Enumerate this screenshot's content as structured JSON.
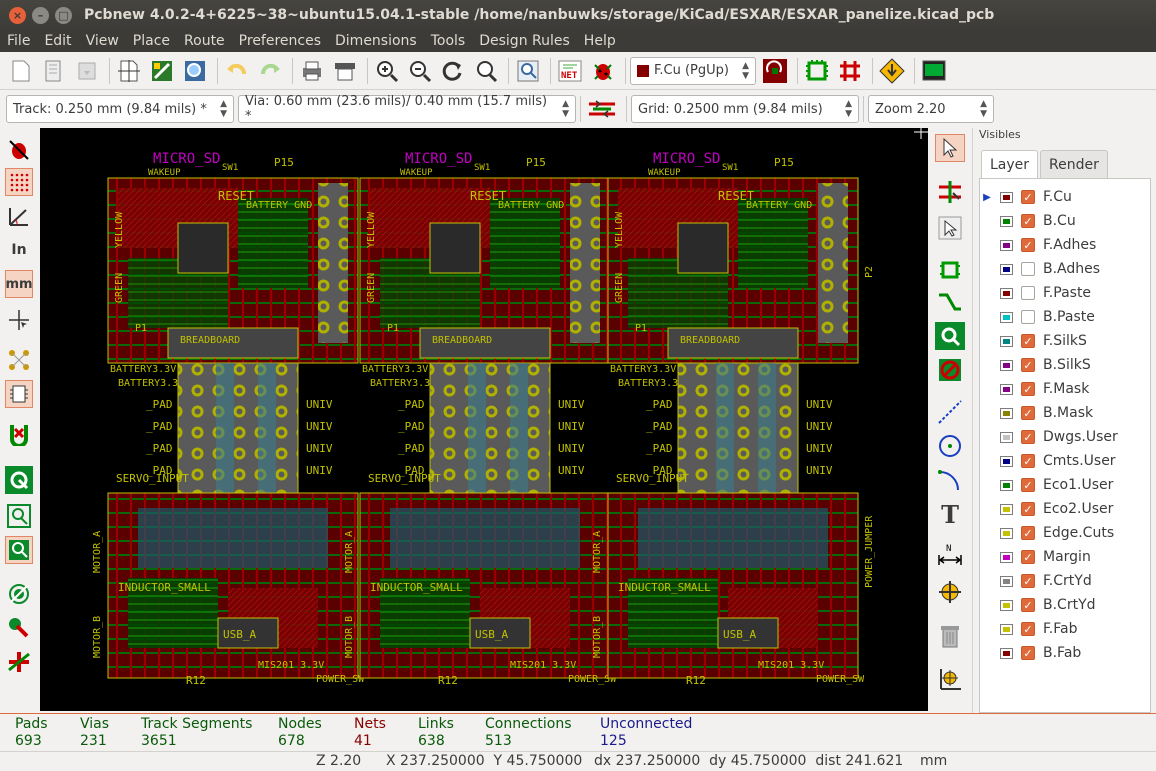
{
  "window": {
    "title": "Pcbnew 4.0.2-4+6225~38~ubuntu15.04.1-stable /home/nanbuwks/storage/KiCad/ESXAR/ESXAR_panelize.kicad_pcb"
  },
  "menu": [
    "File",
    "Edit",
    "View",
    "Place",
    "Route",
    "Preferences",
    "Dimensions",
    "Tools",
    "Design Rules",
    "Help"
  ],
  "toolbar": {
    "layer_select": "F.Cu (PgUp)"
  },
  "toolbar2": {
    "track": "Track: 0.250 mm (9.84 mils) *",
    "via": "Via: 0.60 mm (23.6 mils)/ 0.40 mm (15.7 mils) *",
    "grid": "Grid: 0.2500 mm (9.84 mils)",
    "zoom": "Zoom 2.20"
  },
  "left_toolbar": {
    "inch": "In",
    "mm": "mm"
  },
  "visibles": {
    "title": "Visibles",
    "tabs": [
      "Layer",
      "Render"
    ],
    "layers": [
      {
        "name": "F.Cu",
        "color": "#840000",
        "checked": true,
        "active": true
      },
      {
        "name": "B.Cu",
        "color": "#008400",
        "checked": true
      },
      {
        "name": "F.Adhes",
        "color": "#840084",
        "checked": true
      },
      {
        "name": "B.Adhes",
        "color": "#000084",
        "checked": false
      },
      {
        "name": "F.Paste",
        "color": "#840000",
        "checked": false
      },
      {
        "name": "B.Paste",
        "color": "#00c2c2",
        "checked": false
      },
      {
        "name": "F.SilkS",
        "color": "#008484",
        "checked": true
      },
      {
        "name": "B.SilkS",
        "color": "#840084",
        "checked": true
      },
      {
        "name": "F.Mask",
        "color": "#840084",
        "checked": true
      },
      {
        "name": "B.Mask",
        "color": "#848400",
        "checked": true
      },
      {
        "name": "Dwgs.User",
        "color": "#c2c2c2",
        "checked": true
      },
      {
        "name": "Cmts.User",
        "color": "#000084",
        "checked": true
      },
      {
        "name": "Eco1.User",
        "color": "#008400",
        "checked": true
      },
      {
        "name": "Eco2.User",
        "color": "#c2c200",
        "checked": true
      },
      {
        "name": "Edge.Cuts",
        "color": "#c2c200",
        "checked": true
      },
      {
        "name": "Margin",
        "color": "#c200c2",
        "checked": true
      },
      {
        "name": "F.CrtYd",
        "color": "#848484",
        "checked": true
      },
      {
        "name": "B.CrtYd",
        "color": "#c2c200",
        "checked": true
      },
      {
        "name": "F.Fab",
        "color": "#c2c200",
        "checked": true
      },
      {
        "name": "B.Fab",
        "color": "#840000",
        "checked": true
      }
    ]
  },
  "board_labels": {
    "p15": "P15",
    "wakeup": "WAKEUP",
    "sw1": "SW1",
    "micro_sd": "MICRO_SD",
    "reset": "RESET",
    "battery_gnd": "BATTERY GND",
    "yellow": "YELLOW",
    "green": "GREEN",
    "p2": "P2",
    "p1": "P1",
    "breadboard": "BREADBOARD",
    "battery33v": "BATTERY3.3V",
    "pad": "_PAD",
    "univ": "UNIV",
    "servo": "SERVO_INPUT",
    "motor_a": "MOTOR_A",
    "motor_b": "MOTOR_B",
    "inductor": "INDUCTOR_SMALL",
    "power_jumper": "POWER_JUMPER",
    "usb": "USB_A",
    "r12": "R12",
    "power_sw": "POWER_SW",
    "mis": "MIS201 3.3V"
  },
  "status": {
    "pads_label": "Pads",
    "pads": "693",
    "vias_label": "Vias",
    "vias": "231",
    "tracks_label": "Track Segments",
    "tracks": "3651",
    "nodes_label": "Nodes",
    "nodes": "678",
    "nets_label": "Nets",
    "nets": "41",
    "links_label": "Links",
    "links": "638",
    "conn_label": "Connections",
    "conn": "513",
    "unconn_label": "Unconnected",
    "unconn": "125"
  },
  "bottom": {
    "zoom": "Z 2.20",
    "xy": "X 237.250000  Y 45.750000",
    "dxy": "dx 237.250000  dy 45.750000  dist 241.621",
    "units": "mm"
  }
}
